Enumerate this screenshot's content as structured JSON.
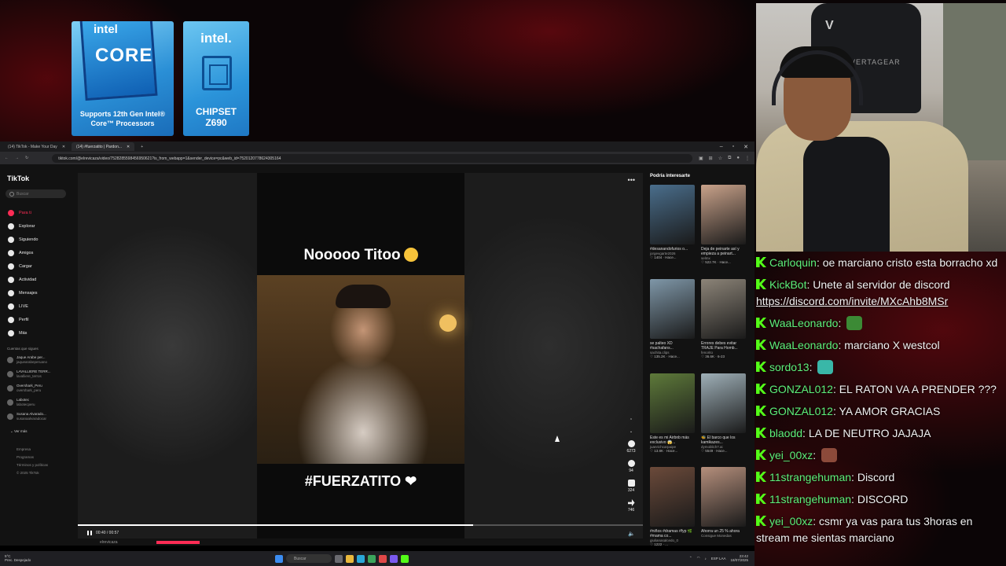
{
  "sponsor": {
    "core_intel": "intel",
    "core_word": "CORE",
    "core_sub": "Supports 12th Gen Intel® Core™ Processors",
    "chip_intel": "intel.",
    "chip_label_1": "CHIPSET",
    "chip_label_2": "Z690"
  },
  "webcam": {
    "chair_logo": "V",
    "chair_brand": "VERTAGEAR"
  },
  "browser": {
    "tabs": [
      "(14) TikTok - Make Your Day",
      "(14) #fuerzatito | Pardon..."
    ],
    "url": "tiktok.com/@elrevicaza/video/7528285598456950621?is_from_webapp=1&sender_device=pc&web_id=7520120778624305164"
  },
  "tiktok": {
    "logo": "TikTok",
    "search_placeholder": "Buscar",
    "nav": [
      "Para ti",
      "Explorar",
      "Siguiendo",
      "Amigos",
      "Cargar",
      "Actividad",
      "Mensajes",
      "LIVE",
      "Perfil",
      "Más"
    ],
    "following_header": "Cuentas que sigues",
    "following": [
      {
        "name": "Jaque Arabe per...",
        "handle": "jaquearabeperuano"
      },
      {
        "name": "LAVALLIERE TERR...",
        "handle": "lavalliere_terros"
      },
      {
        "name": "Overshark_Peru",
        "handle": "overshark_peru"
      },
      {
        "name": "Labotec",
        "handle": "labotecperu"
      },
      {
        "name": "Susana Alvarado...",
        "handle": "susanaalvaradocar"
      }
    ],
    "see_more": "Ver más",
    "footer": [
      "Empresa",
      "Programas",
      "Términos y políticas",
      "© 2025 TikTok"
    ],
    "video": {
      "title": "Nooooo Titoo",
      "tag": "#FUERZATITO ❤",
      "time": "00:40 / 00:57",
      "progress_fraction": 0.7,
      "likes": "6273",
      "comments": "94",
      "saves": "324",
      "shares": "746",
      "more": "•••",
      "user": "elrevicaza"
    },
    "recs_header": "Podría interesarte",
    "recs": [
      {
        "cap": "#desanandofurios o...",
        "au": "jorgevgarte2026",
        "st": "♡ 1404 · Hace...",
        "color": "#4a6e8c"
      },
      {
        "cap": "Deja de peinarte así y empieza a peinart...",
        "au": "selmx",
        "st": "♡ 522.7K · Hace...",
        "color": "#c9a28a"
      },
      {
        "cap": "se palteo XD #sachafans...",
        "au": "sachita.clips",
        "st": "♡ 135.2K · Hace...",
        "color": "#7f97a8"
      },
      {
        "cap": "Errores debes evitar TRAJE Para Homb...",
        "au": "fenorito",
        "st": "♡ 36.6K · 6-23",
        "color": "#8c8478"
      },
      {
        "cap": "Este es mi Airbnb más exclusivo 😱...",
        "au": "juanrichcarpaipe",
        "st": "♡ 13.8K · Hace...",
        "color": "#5e7a3a"
      },
      {
        "cap": "🐝 El barco que los kamikazes...",
        "au": "dymoblich7.ai",
        "st": "♡ 5549 · Hace...",
        "color": "#9fb0b8"
      },
      {
        "cap": "#niños #dramas #fyp 🌿 #mama co...",
        "au": "giulianasalcedo_0",
        "st": "♡ 1222 · ...",
        "color": "#6b4a3a"
      },
      {
        "cap": "Ahorra un 25 % ahora",
        "au": "Consigue Monedas",
        "st": "",
        "color": "#b58f7c"
      }
    ]
  },
  "taskbar": {
    "weather_temp": "5°C",
    "weather_desc": "Prec. Despejado",
    "search": "Buscar",
    "lang": "ESP LAA",
    "time": "23:42",
    "date": "18/07/2025"
  },
  "chat": [
    {
      "user": "Carloquin",
      "text": "oe marciano cristo esta borracho xd"
    },
    {
      "user": "KickBot",
      "text": "Unete al servidor de discord ",
      "link": "https://discord.com/invite/MXcAhb8MSr"
    },
    {
      "user": "WaaLeonardo",
      "text": "",
      "emote": "#3c8a35"
    },
    {
      "user": "WaaLeonardo",
      "text": "marciano X westcol"
    },
    {
      "user": "sordo13",
      "text": "",
      "emote": "#39b7a8"
    },
    {
      "user": "GONZAL012",
      "text": "EL RATON VA A PRENDER ???"
    },
    {
      "user": "GONZAL012",
      "text": "YA AMOR GRACIAS"
    },
    {
      "user": "blaodd",
      "text": "LA DE NEUTRO JAJAJA"
    },
    {
      "user": "yei_00xz",
      "text": "",
      "emote": "#8c4a3a"
    },
    {
      "user": "11strangehuman",
      "text": "Discord"
    },
    {
      "user": "11strangehuman",
      "text": "DISCORD"
    },
    {
      "user": "yei_00xz",
      "text": "csmr ya vas para tus 3horas en stream me sientas marciano"
    }
  ]
}
